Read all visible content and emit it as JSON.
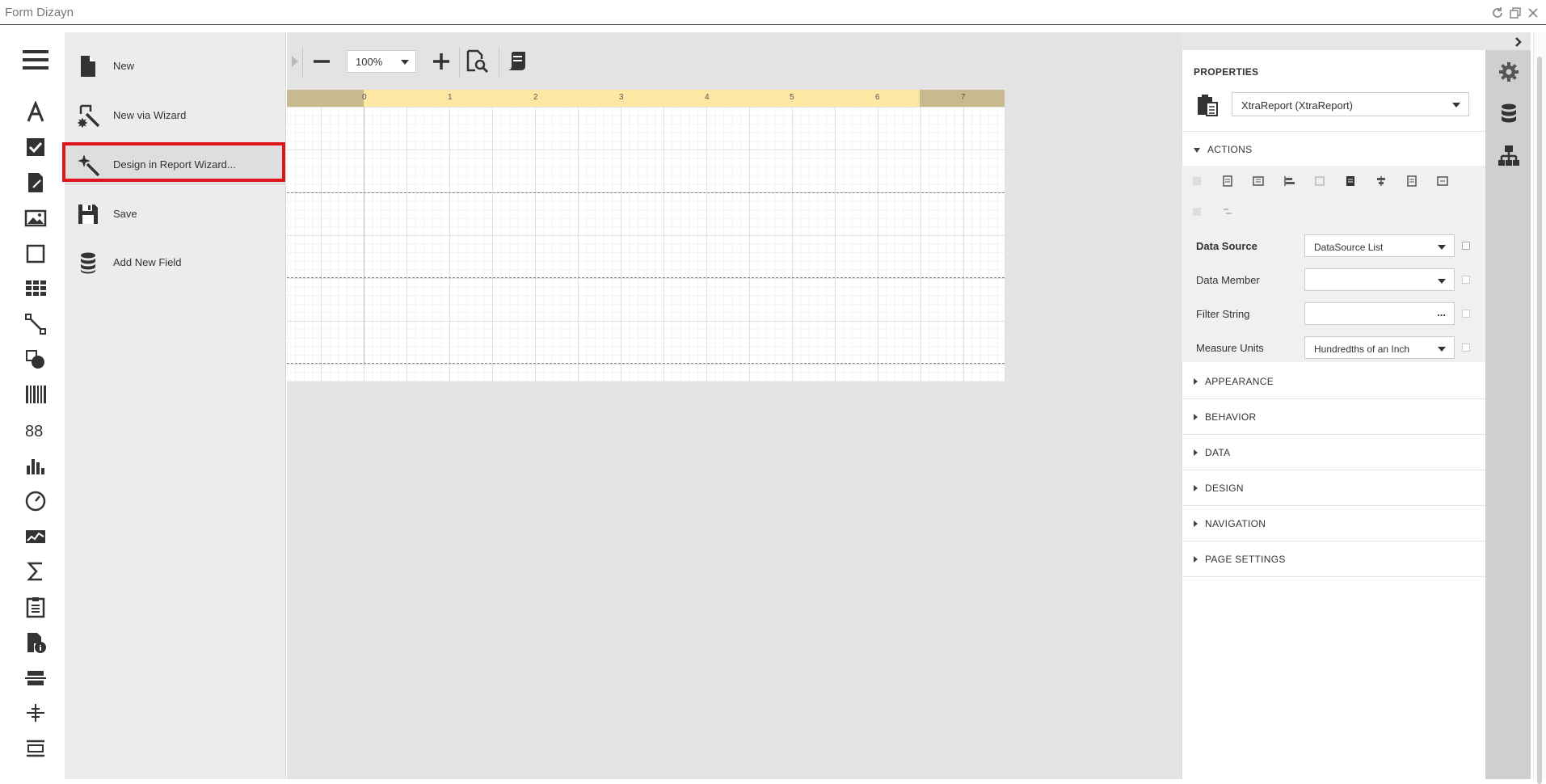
{
  "window": {
    "title": "Form Dizayn"
  },
  "menu": {
    "items": [
      {
        "label": "New",
        "icon": "new-document-icon"
      },
      {
        "label": "New via Wizard",
        "icon": "wizard-icon"
      },
      {
        "label": "Design in Report Wizard...",
        "icon": "magic-wand-icon"
      },
      {
        "label": "Save",
        "icon": "save-icon"
      },
      {
        "label": "Add New Field",
        "icon": "database-icon"
      }
    ],
    "highlighted_index": 2
  },
  "toolbar": {
    "zoom": "100%"
  },
  "ruler": {
    "marks": [
      "0",
      "1",
      "2",
      "3",
      "4",
      "5",
      "6",
      "7"
    ]
  },
  "properties": {
    "title": "PROPERTIES",
    "selected_component": "XtraReport (XtraReport)",
    "sections": {
      "actions": "ACTIONS",
      "appearance": "APPEARANCE",
      "behavior": "BEHAVIOR",
      "data": "DATA",
      "design": "DESIGN",
      "navigation": "NAVIGATION",
      "page_settings": "PAGE SETTINGS"
    },
    "fields": [
      {
        "label": "Data Source",
        "value": "DataSource List",
        "bold": true
      },
      {
        "label": "Data Member",
        "value": ""
      },
      {
        "label": "Filter String",
        "value": ""
      },
      {
        "label": "Measure Units",
        "value": "Hundredths of an Inch"
      }
    ],
    "filter_button": "..."
  },
  "colors": {
    "highlight": "#e0141c",
    "ruler_active": "#fde8a3",
    "ruler_margin": "#c8b98e"
  }
}
